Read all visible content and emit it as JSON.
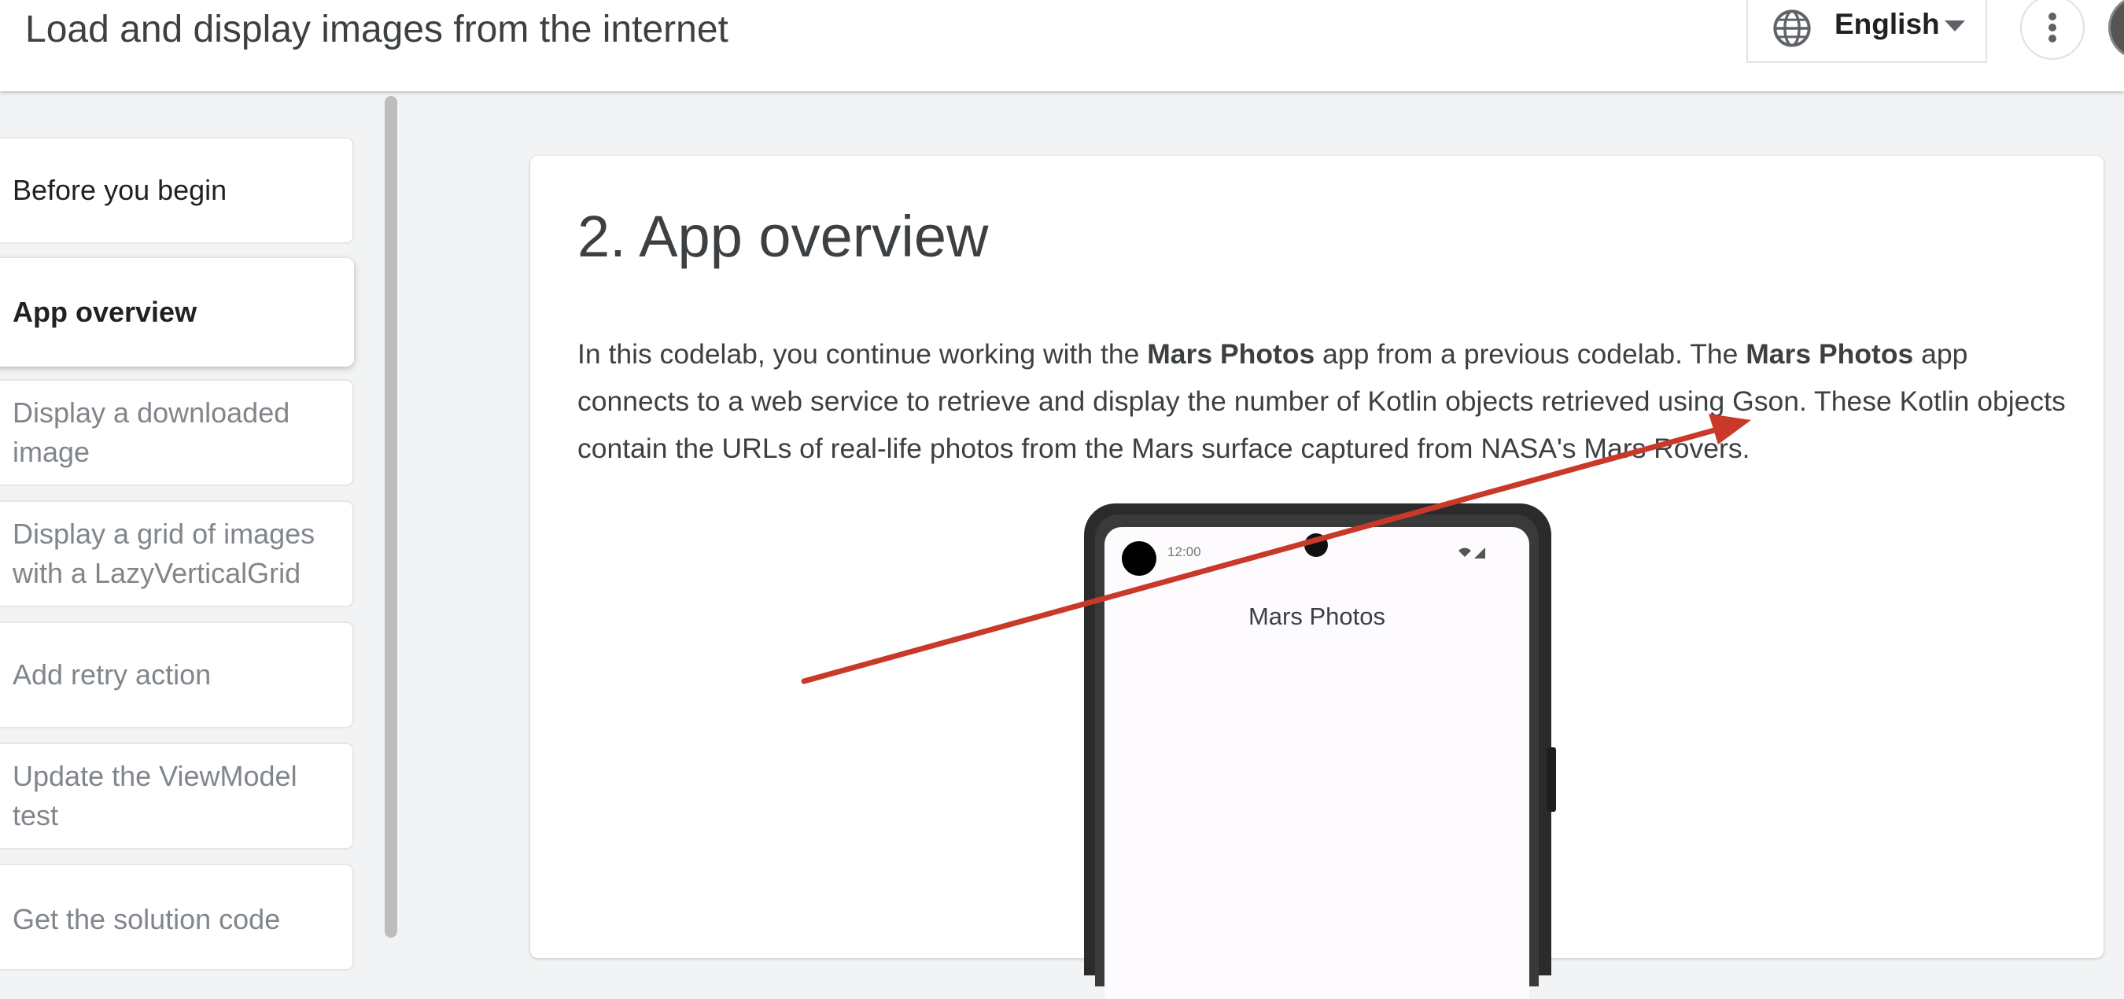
{
  "header": {
    "title": "Load and display images from the internet",
    "language": "English"
  },
  "sidebar": {
    "steps": [
      {
        "label": "Before you begin",
        "state": "done"
      },
      {
        "label": "App overview",
        "state": "active"
      },
      {
        "label": "Display a downloaded image",
        "state": "todo"
      },
      {
        "label": "Display a grid of images with a LazyVerticalGrid",
        "state": "todo"
      },
      {
        "label": "Add retry action",
        "state": "todo"
      },
      {
        "label": "Update the ViewModel test",
        "state": "todo"
      },
      {
        "label": "Get the solution code",
        "state": "todo"
      }
    ]
  },
  "content": {
    "section_title": "2. App overview",
    "para": {
      "p1": "In this codelab, you continue working with the ",
      "b1": "Mars Photos",
      "p2": " app from a previous codelab. The ",
      "b2": "Mars Photos",
      "p3": " app connects to a web service to retrieve and display the number of Kotlin objects retrieved using Gson. These Kotlin objects contain the URLs of real-life photos from the Mars surface captured from NASA's Mars Rovers."
    },
    "phone": {
      "status_time": "12:00",
      "app_title": "Mars Photos"
    }
  },
  "colors": {
    "annotation_arrow": "#c9392a",
    "accent_text": "#3c4043"
  },
  "icons": [
    "globe-icon",
    "chevron-down-icon",
    "more-vert-icon",
    "avatar"
  ]
}
